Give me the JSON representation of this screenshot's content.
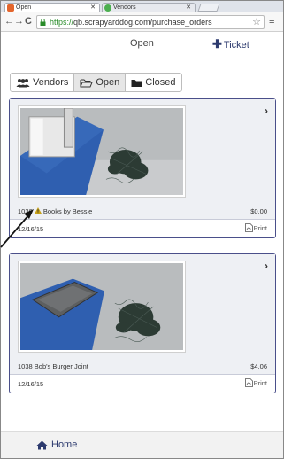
{
  "browser": {
    "tabs": [
      {
        "title": "Open",
        "active": true
      },
      {
        "title": "Vendors",
        "active": false
      }
    ],
    "url_scheme": "https://",
    "url_rest": "qb.scrapyarddog.com/purchase_orders"
  },
  "header": {
    "title": "Open",
    "ticket_label": "Ticket"
  },
  "filters": {
    "items": [
      {
        "label": "Vendors",
        "icon": "users-icon",
        "active": false
      },
      {
        "label": "Open",
        "icon": "folder-open-icon",
        "active": true
      },
      {
        "label": "Closed",
        "icon": "folder-icon",
        "active": false
      }
    ]
  },
  "orders": [
    {
      "number": "1036",
      "vendor": "Books by Bessie",
      "amount": "$0.00",
      "date": "12/16/15",
      "print_label": "Print",
      "warning": true
    },
    {
      "number": "1038",
      "vendor": "Bob's Burger Joint",
      "amount": "$4.06",
      "date": "12/16/15",
      "print_label": "Print",
      "warning": false
    }
  ],
  "footer": {
    "home_label": "Home"
  },
  "colors": {
    "accent": "#2c3a6e",
    "card_border": "#4a4f8a",
    "scale_blue": "#2f5fb0"
  }
}
